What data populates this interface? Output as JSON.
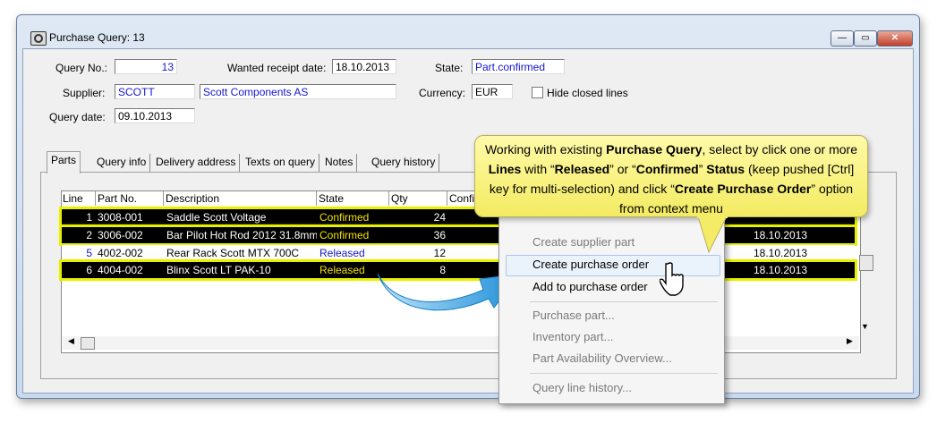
{
  "window": {
    "title": "Purchase Query: 13",
    "min_label": "—",
    "max_label": "▭",
    "close_label": "✕"
  },
  "header": {
    "query_no_label": "Query No.:",
    "query_no": "13",
    "wanted_label": "Wanted receipt date:",
    "wanted_date": "18.10.2013",
    "state_label": "State:",
    "state": "Part.confirmed",
    "supplier_label": "Supplier:",
    "supplier_code": "SCOTT",
    "supplier_name": "Scott Components AS",
    "currency_label": "Currency:",
    "currency": "EUR",
    "hide_closed_label": "Hide closed lines",
    "query_date_label": "Query date:",
    "query_date": "09.10.2013"
  },
  "tabs": [
    "Parts",
    "Query info",
    "Delivery address",
    "Texts on query",
    "Notes",
    "Query history"
  ],
  "table": {
    "columns": [
      "Line",
      "Part No.",
      "Description",
      "State",
      "Qty",
      "Confi"
    ],
    "rows": [
      {
        "line": "1",
        "part": "3008-001",
        "desc": "Saddle Scott Voltage",
        "state": "Confirmed",
        "qty": "24",
        "date": "",
        "selected": true
      },
      {
        "line": "2",
        "part": "3006-002",
        "desc": "Bar Pilot Hot Rod 2012 31.8mm I",
        "state": "Confirmed",
        "qty": "36",
        "date": "18.10.2013",
        "selected": true
      },
      {
        "line": "5",
        "part": "4002-002",
        "desc": "Rear Rack Scott MTX 700C",
        "state": "Released",
        "qty": "12",
        "date": "18.10.2013",
        "selected": false
      },
      {
        "line": "6",
        "part": "4004-002",
        "desc": "Blinx Scott LT PAK-10",
        "state": "Released",
        "qty": "8",
        "date": "18.10.2013",
        "selected": true
      }
    ]
  },
  "context_menu": {
    "items": [
      {
        "label": "Create supplier part",
        "enabled": false
      },
      {
        "label": "Create purchase order",
        "enabled": true
      },
      {
        "label": "Add to purchase order",
        "enabled": true
      },
      {
        "label": "Purchase part...",
        "enabled": false
      },
      {
        "label": "Inventory part...",
        "enabled": false
      },
      {
        "label": "Part Availability Overview...",
        "enabled": false
      },
      {
        "label": "Query line history...",
        "enabled": false
      }
    ]
  },
  "callout": {
    "p1": "Working with existing ",
    "b1": "Purchase Query",
    "p2": ", select by click one or more ",
    "b2": "Lines",
    "p3": " with “",
    "b3": "Released",
    "p4": "” or “",
    "b4": "Confirmed",
    "p5": "” ",
    "b5": "Status",
    "p6": " (keep pushed [Ctrl] key for multi-selection) and click “",
    "b6": "Create Purchase Order",
    "p7": "” option from context menu"
  },
  "colors": {
    "selection_outline": "#e6f000",
    "selected_row_bg": "#000000",
    "state_confirmed": "#f0e000",
    "callout_bg": "#fffaa8",
    "arrow": "#3aa0e0"
  },
  "icons": {
    "app": "purchase-query-icon",
    "cursor": "hand-pointer-icon",
    "arrow": "curved-arrow-icon"
  }
}
